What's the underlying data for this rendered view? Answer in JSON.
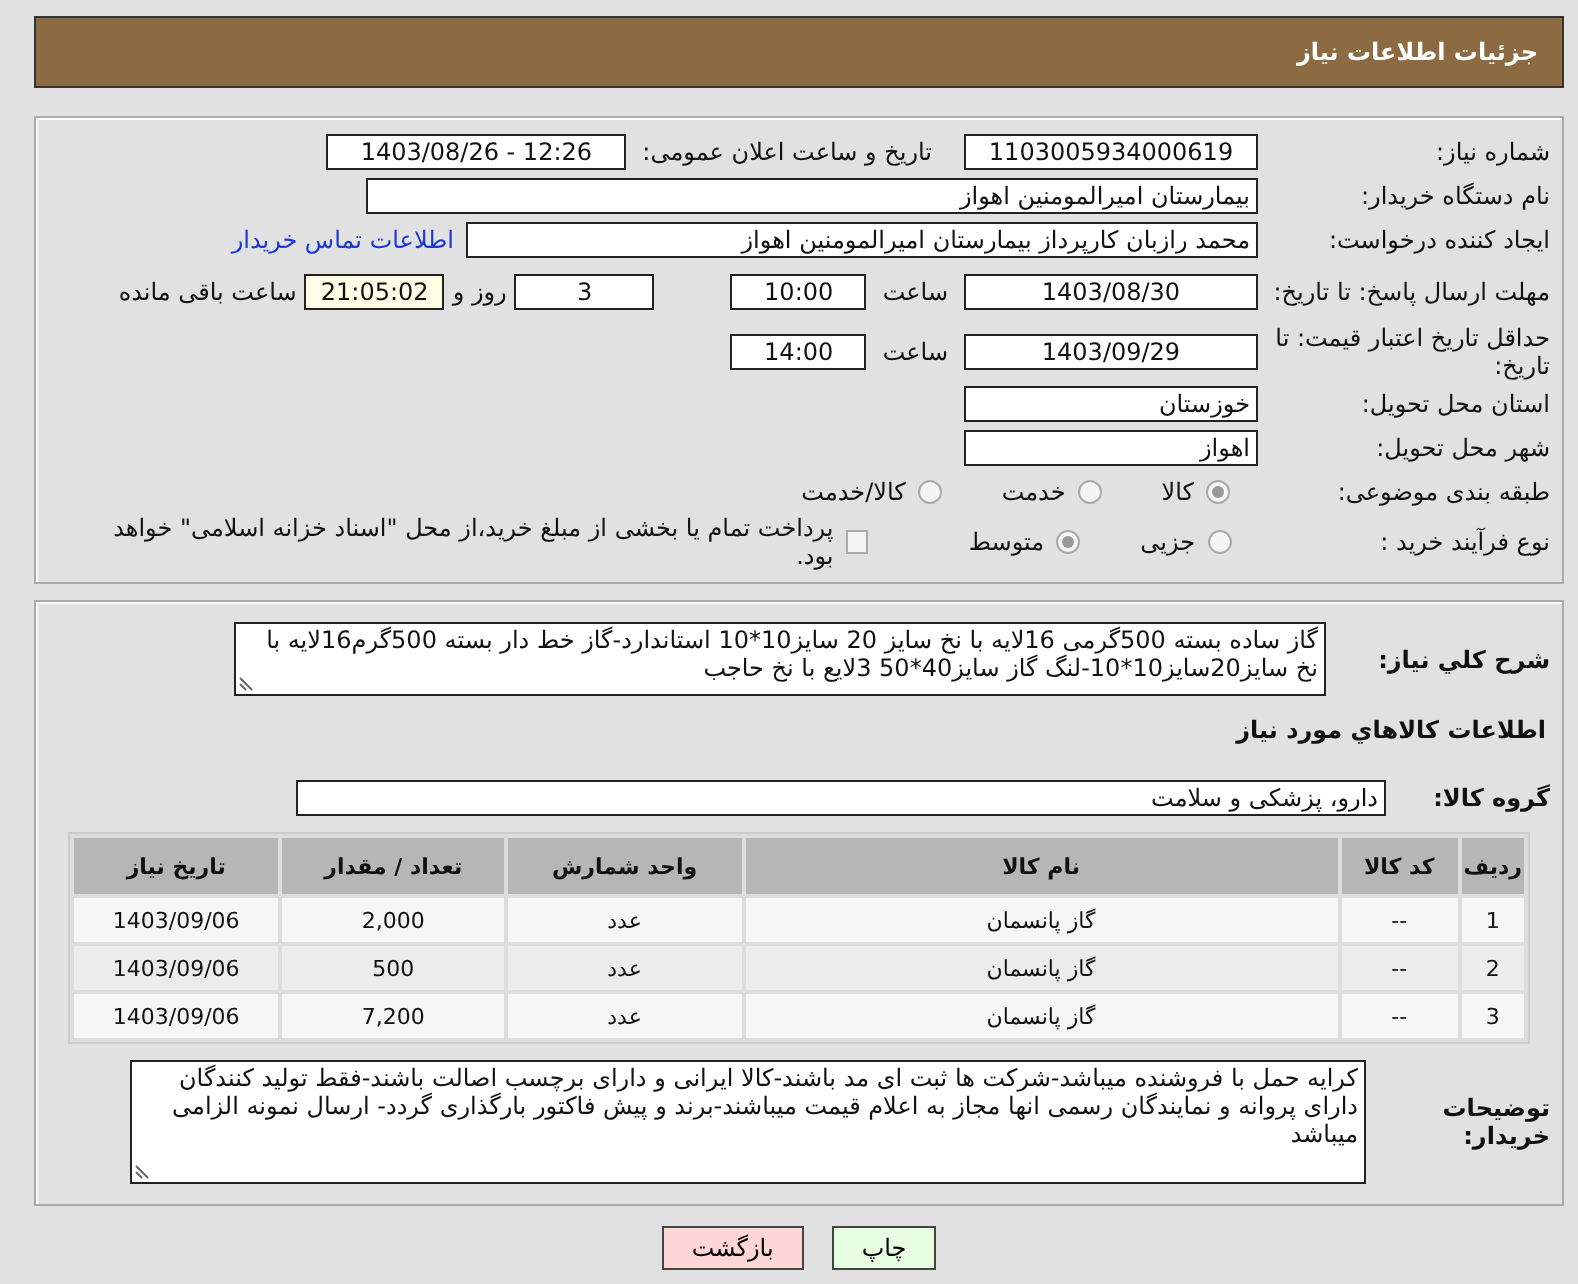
{
  "header": {
    "title": "جزئیات اطلاعات نیاز"
  },
  "need_number": {
    "label": "شماره نیاز:",
    "value": "1103005934000619"
  },
  "announce": {
    "label": "تاریخ و ساعت اعلان عمومی:",
    "value": "1403/08/26 - 12:26"
  },
  "buyer_org": {
    "label": "نام دستگاه خریدار:",
    "value": "بیمارستان امیرالمومنین اهواز"
  },
  "requester": {
    "label": "ایجاد کننده درخواست:",
    "value": "محمد رازبان کارپرداز بیمارستان امیرالمومنین اهواز",
    "link": "اطلاعات تماس خریدار"
  },
  "reply_deadline": {
    "label": "مهلت ارسال پاسخ: تا تاریخ:",
    "date": "1403/08/30",
    "time_label": "ساعت",
    "time": "10:00",
    "days": "3",
    "days_label": "روز و",
    "remaining": "21:05:02",
    "remaining_label": "ساعت باقی مانده"
  },
  "price_validity": {
    "label": "حداقل تاریخ اعتبار قیمت: تا تاریخ:",
    "date": "1403/09/29",
    "time_label": "ساعت",
    "time": "14:00"
  },
  "province": {
    "label": "استان محل تحویل:",
    "value": "خوزستان"
  },
  "city": {
    "label": "شهر محل تحویل:",
    "value": "اهواز"
  },
  "category": {
    "label": "طبقه بندی موضوعی:",
    "options": [
      {
        "label": "کالا",
        "selected": true
      },
      {
        "label": "خدمت",
        "selected": false
      },
      {
        "label": "کالا/خدمت",
        "selected": false
      }
    ]
  },
  "process": {
    "label": "نوع فرآیند خرید :",
    "options": [
      {
        "label": "جزیی",
        "selected": false
      },
      {
        "label": "متوسط",
        "selected": true
      }
    ],
    "payment": {
      "label": "پرداخت تمام یا بخشی از مبلغ خرید،از محل \"اسناد خزانه اسلامی\" خواهد بود.",
      "checked": false
    }
  },
  "description": {
    "label": "شرح کلي نياز:",
    "value": "گاز ساده بسته 500گرمی 16لایه با نخ سایز 20 سایز10*10 استاندارد-گاز خط دار بسته 500گرم16لایه با نخ سایز20سایز10*10-لنگ گاز سایز40*50 3لایع با نخ حاجب"
  },
  "goods_heading": "اطلاعات کالاهاي مورد نياز",
  "goods_group": {
    "label": "گروه کالا:",
    "value": "دارو، پزشکی و سلامت"
  },
  "table": {
    "columns": [
      "ردیف",
      "کد کالا",
      "نام کالا",
      "واحد شمارش",
      "تعداد / مقدار",
      "تاریخ نیاز"
    ],
    "rows": [
      [
        "1",
        "--",
        "گاز پانسمان",
        "عدد",
        "2,000",
        "1403/09/06"
      ],
      [
        "2",
        "--",
        "گاز پانسمان",
        "عدد",
        "500",
        "1403/09/06"
      ],
      [
        "3",
        "--",
        "گاز پانسمان",
        "عدد",
        "7,200",
        "1403/09/06"
      ]
    ]
  },
  "buyer_notes": {
    "label": "توضیحات خریدار:",
    "value": "کرایه حمل با فروشنده میباشد-شرکت ها ثبت ای مد باشند-کالا ایرانی و دارای برچسب اصالت باشند-فقط تولید کنندگان دارای پروانه و نمایندگان رسمی انها مجاز به اعلام قیمت میباشند-برند و پیش فاکتور بارگذاری گردد- ارسال نمونه الزامی میباشد"
  },
  "buttons": [
    {
      "label": "چاپ",
      "kind": "print"
    },
    {
      "label": "بازگشت",
      "kind": "back"
    }
  ]
}
